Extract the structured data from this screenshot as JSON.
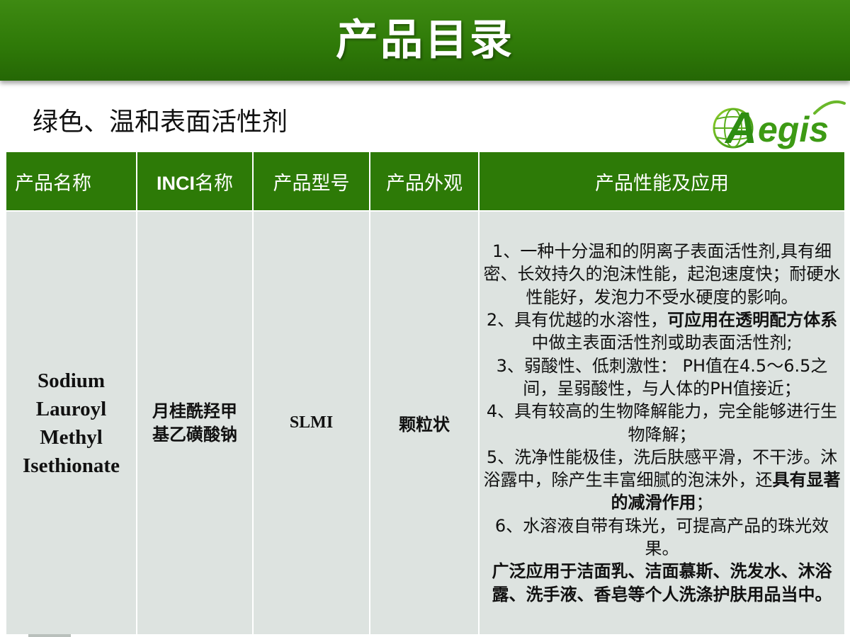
{
  "slide": {
    "title": "产品目录",
    "subtitle": "绿色、温和表面活性剂",
    "logo_text": "Aegis",
    "brand_green": "#2d7a07"
  },
  "table": {
    "headers": {
      "name": "产品名称",
      "inci_prefix": "INCI",
      "inci_suffix": "名称",
      "model": "产品型号",
      "appearance": "产品外观",
      "performance": "产品性能及应用"
    },
    "row": {
      "name_lines": [
        "Sodium",
        "Lauroyl",
        "Methyl",
        "Isethionate"
      ],
      "inci_lines": [
        "月桂酰羟甲",
        "基乙磺酸钠"
      ],
      "model": "SLMI",
      "appearance": "颗粒状",
      "performance": {
        "p1": "1、一种十分温和的阴离子表面活性剂,具有细密、长效持久的泡沫性能，起泡速度快；耐硬水性能好，发泡力不受水硬度的影响。",
        "p2_a": "2、具有优越的水溶性，",
        "p2_b": "可应用在透明配方体系",
        "p2_c": "中做主表面活性剂或助表面活性剂;",
        "p3": "3、弱酸性、低刺激性： PH值在4.5～6.5之间，呈弱酸性，与人体的PH值接近；",
        "p4": "4、具有较高的生物降解能力，完全能够进行生物降解；",
        "p5_a": "5、洗净性能极佳，洗后肤感平滑，不干涉。沐浴露中，除产生丰富细腻的泡沫外，还",
        "p5_b": "具有显著的减滑作用",
        "p5_c": "；",
        "p6": "6、水溶液自带有珠光，可提高产品的珠光效果。",
        "p7": "广泛应用于洁面乳、洁面慕斯、洗发水、沐浴露、洗手液、香皂等个人洗涤护肤用品当中。"
      }
    }
  }
}
